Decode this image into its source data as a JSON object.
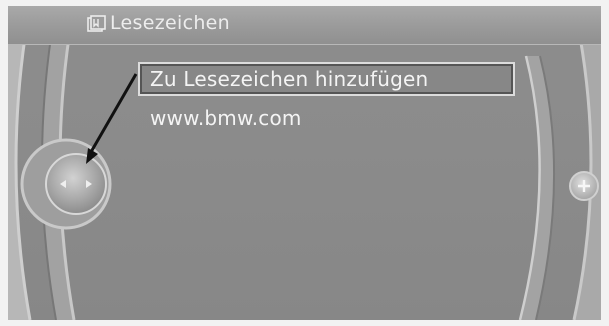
{
  "header": {
    "icon": "bookmark-icon",
    "title": "Lesezeichen"
  },
  "menu": {
    "items": [
      {
        "label": "Zu Lesezeichen hinzufügen",
        "selected": true
      },
      {
        "label": "www.bmw.com",
        "selected": false
      }
    ]
  },
  "controller": {
    "left_icon": "controller-knob-icon",
    "right_icon": "plus-icon"
  },
  "colors": {
    "background": "#8b8b8b",
    "text": "#f4f4f4",
    "highlight_border": "#dcdcdc"
  }
}
